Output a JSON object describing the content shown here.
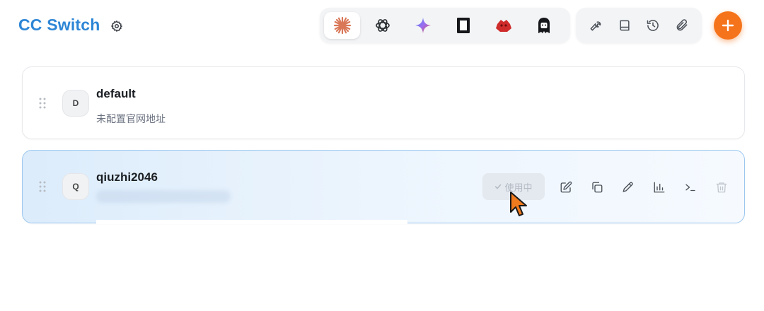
{
  "header": {
    "title": "CC Switch",
    "settings_icon": "gear-icon",
    "app_tabs": [
      {
        "name": "claude",
        "icon": "claude-icon",
        "active": true
      },
      {
        "name": "codex",
        "icon": "openai-icon",
        "active": false
      },
      {
        "name": "gemini",
        "icon": "gemini-icon",
        "active": false
      },
      {
        "name": "app-4",
        "icon": "square-app-icon",
        "active": false
      },
      {
        "name": "app-5",
        "icon": "red-app-icon",
        "active": false
      },
      {
        "name": "app-6",
        "icon": "character-app-icon",
        "active": false
      }
    ],
    "tools": [
      {
        "name": "wrench",
        "icon": "wrench-icon"
      },
      {
        "name": "book",
        "icon": "book-icon"
      },
      {
        "name": "history",
        "icon": "history-icon"
      },
      {
        "name": "plugins",
        "icon": "paperclip-icon"
      }
    ],
    "add_icon": "plus-icon",
    "accent_color": "#f5731a",
    "brand_color": "#2e86d6"
  },
  "providers": [
    {
      "avatar_letter": "D",
      "name": "default",
      "subtitle": "未配置官网地址",
      "active": false
    },
    {
      "avatar_letter": "Q",
      "name": "qiuzhi2046",
      "subtitle": "",
      "active": true,
      "status_label": "使用中",
      "actions": [
        "edit-icon",
        "duplicate-icon",
        "pen-icon",
        "bar-chart-icon",
        "terminal-icon",
        "trash-icon"
      ]
    }
  ]
}
